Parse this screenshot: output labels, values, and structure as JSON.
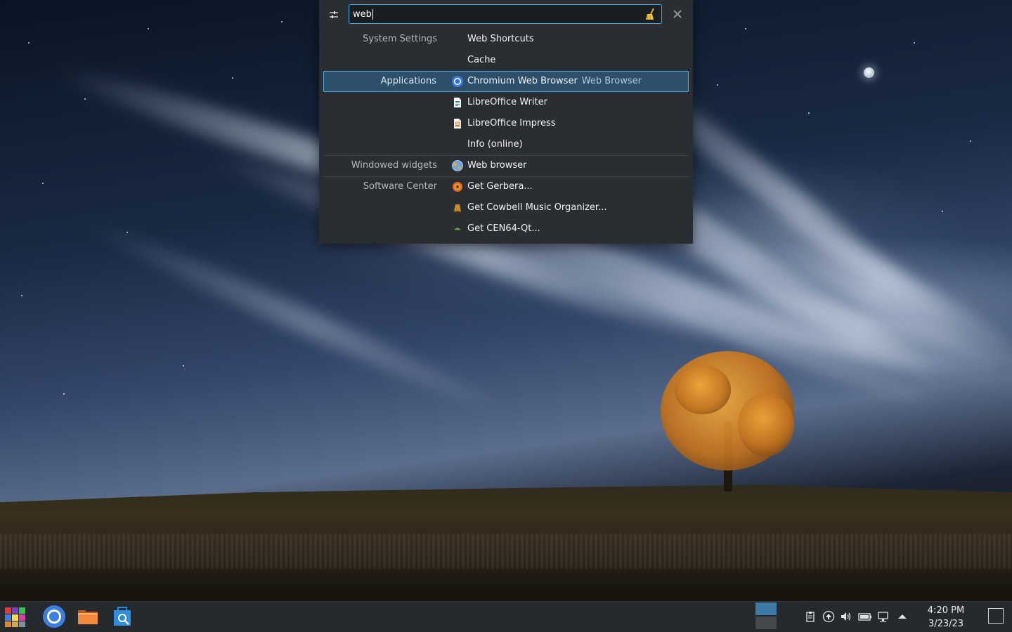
{
  "search": {
    "value": "web"
  },
  "results": [
    {
      "category": "System Settings",
      "label": "Web Shortcuts",
      "subtext": "",
      "icon": "none",
      "selected": false
    },
    {
      "category": "",
      "label": "Cache",
      "subtext": "",
      "icon": "none",
      "selected": false
    },
    {
      "category": "Applications",
      "label": "Chromium Web Browser",
      "subtext": "Web Browser",
      "icon": "chromium-icon",
      "selected": true
    },
    {
      "category": "",
      "label": "LibreOffice Writer",
      "subtext": "",
      "icon": "libreoffice-writer-icon",
      "selected": false
    },
    {
      "category": "",
      "label": "LibreOffice Impress",
      "subtext": "",
      "icon": "libreoffice-impress-icon",
      "selected": false
    },
    {
      "category": "",
      "label": "Info (online)",
      "subtext": "",
      "icon": "none",
      "selected": false
    },
    {
      "category": "Windowed widgets",
      "label": "Web browser",
      "subtext": "",
      "icon": "globe-icon",
      "selected": false
    },
    {
      "category": "Software Center",
      "label": "Get Gerbera...",
      "subtext": "",
      "icon": "gerbera-icon",
      "selected": false
    },
    {
      "category": "",
      "label": "Get Cowbell Music Organizer...",
      "subtext": "",
      "icon": "cowbell-icon",
      "selected": false
    },
    {
      "category": "",
      "label": "Get CEN64-Qt...",
      "subtext": "",
      "icon": "cen64-icon",
      "selected": false
    }
  ],
  "taskbar": {
    "launchers": [
      "app-launcher-icon",
      "chromium-icon",
      "file-manager-icon",
      "discover-icon"
    ],
    "tray_icons": [
      "clipboard-icon",
      "updates-icon",
      "volume-icon",
      "battery-icon",
      "network-icon",
      "expand-arrow-icon"
    ],
    "clock": {
      "time": "4:20 PM",
      "date": "3/23/23"
    }
  },
  "colors": {
    "accent": "#3daee9",
    "selection": "#2c4f6c",
    "panel": "#26292d",
    "runner_bg": "#2a2e32"
  }
}
